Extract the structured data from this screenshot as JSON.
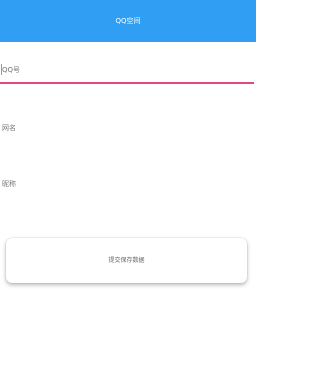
{
  "app_bar": {
    "title": "QQ空间",
    "color": "#2f9ef3"
  },
  "form": {
    "fields": [
      {
        "label": "QQ号",
        "value": ""
      },
      {
        "label": "网名",
        "value": ""
      },
      {
        "label": "昵称",
        "value": ""
      }
    ],
    "active_underline_color": "#e0487f",
    "submit_label": "提交保存数据"
  }
}
